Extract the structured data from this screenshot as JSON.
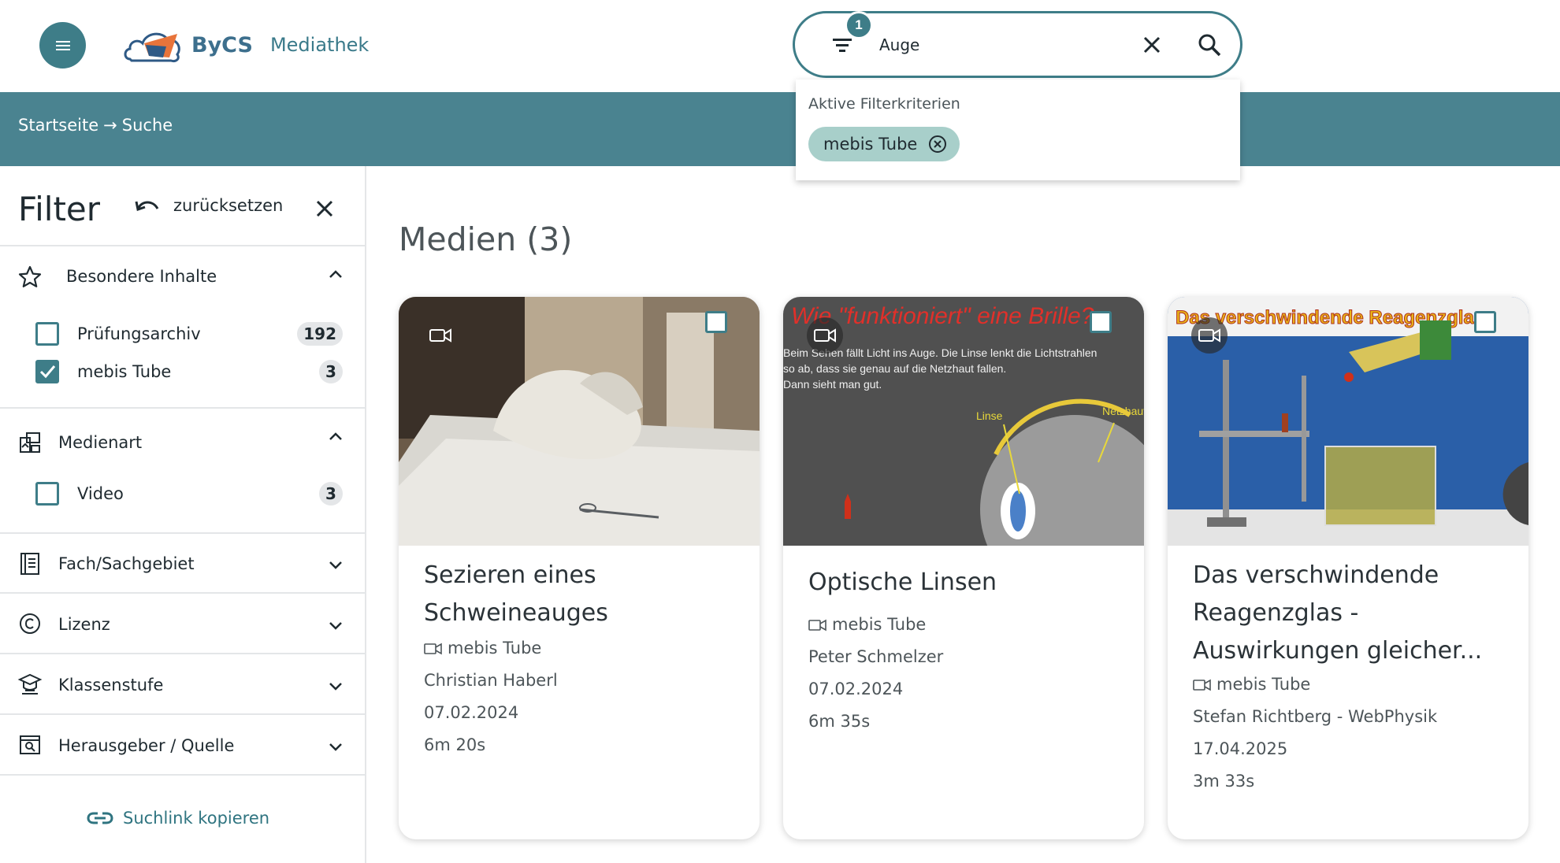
{
  "header": {
    "logo_brand": "ByCS",
    "logo_product": "Mediathek",
    "search_value": "Auge",
    "filter_count": "1"
  },
  "banner": {
    "breadcrumb_home": "Startseite",
    "breadcrumb_sep": "→",
    "breadcrumb_current": "Suche"
  },
  "dropdown": {
    "title": "Aktive Filterkriterien",
    "chip_label": "mebis Tube"
  },
  "sidebar": {
    "title": "Filter",
    "reset_label": "zurücksetzen",
    "sections": [
      {
        "label": "Besondere Inhalte",
        "icon": "star-icon",
        "expanded": true,
        "options": [
          {
            "label": "Prüfungsarchiv",
            "count": "192",
            "checked": false
          },
          {
            "label": "mebis Tube",
            "count": "3",
            "checked": true
          }
        ]
      },
      {
        "label": "Medienart",
        "icon": "media-type-icon",
        "expanded": true,
        "options": [
          {
            "label": "Video",
            "count": "3",
            "checked": false
          }
        ]
      },
      {
        "label": "Fach/Sachgebiet",
        "icon": "book-icon",
        "expanded": false
      },
      {
        "label": "Lizenz",
        "icon": "copyright-icon",
        "expanded": false
      },
      {
        "label": "Klassenstufe",
        "icon": "graduation-icon",
        "expanded": false
      },
      {
        "label": "Herausgeber / Quelle",
        "icon": "publisher-search-icon",
        "expanded": false
      }
    ],
    "copy_link_label": "Suchlink kopieren"
  },
  "main": {
    "title": "Medien (3)",
    "cards": [
      {
        "title_line1": "Sezieren eines",
        "title_line2": "Schweineauges",
        "source": "mebis Tube",
        "author": "Christian Haberl",
        "date": "07.02.2024",
        "duration": "6m 20s"
      },
      {
        "title_line1": "Optische Linsen",
        "source": "mebis Tube",
        "author": "Peter Schmelzer",
        "date": "07.02.2024",
        "duration": "6m 35s",
        "thumb_heading": "Wie \"funktioniert\" eine Brille?",
        "thumb_text1": "Beim Sehen fällt Licht ins Auge. Die Linse lenkt die Lichtstrahlen",
        "thumb_text2": "so ab, dass sie genau auf die Netzhaut fallen.",
        "thumb_text3": "Dann sieht man gut.",
        "thumb_label_lens": "Linse",
        "thumb_label_retina": "Netzhaut"
      },
      {
        "title_line1": "Das verschwindende",
        "title_line2": "Reagenzglas -",
        "title_line3": "Auswirkungen gleicher...",
        "source": "mebis Tube",
        "author": "Stefan Richtberg - WebPhysik",
        "date": "17.04.2025",
        "duration": "3m 33s",
        "thumb_heading": "Das verschwindende Reagenzglas"
      }
    ]
  },
  "colors": {
    "teal": "#3e7d88",
    "banner": "#4a8390",
    "chip": "#a8cfca"
  }
}
